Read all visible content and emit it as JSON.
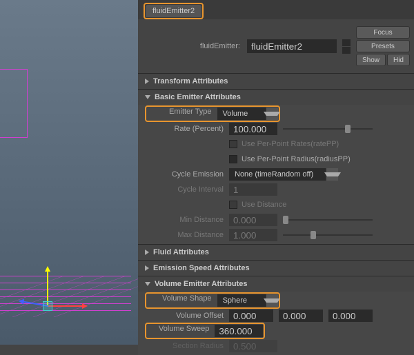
{
  "tab": {
    "title": "fluidEmitter2"
  },
  "header": {
    "name_label": "fluidEmitter:",
    "name_value": "fluidEmitter2",
    "focus": "Focus",
    "presets": "Presets",
    "show": "Show",
    "hide": "Hid"
  },
  "sections": {
    "transform": {
      "title": "Transform Attributes"
    },
    "basic": {
      "title": "Basic Emitter Attributes",
      "emitter_type_label": "Emitter Type",
      "emitter_type_value": "Volume",
      "rate_label": "Rate (Percent)",
      "rate_value": "100.000",
      "ratePP_label": "Use Per-Point Rates(ratePP)",
      "radiusPP_label": "Use Per-Point Radius(radiusPP)",
      "cycle_label": "Cycle Emission",
      "cycle_value": "None (timeRandom off)",
      "cycle_interval_label": "Cycle Interval",
      "cycle_interval_value": "1",
      "use_distance_label": "Use Distance",
      "min_dist_label": "Min Distance",
      "min_dist_value": "0.000",
      "max_dist_label": "Max Distance",
      "max_dist_value": "1.000"
    },
    "fluid": {
      "title": "Fluid Attributes"
    },
    "emission_speed": {
      "title": "Emission Speed Attributes"
    },
    "volume": {
      "title": "Volume Emitter Attributes",
      "shape_label": "Volume Shape",
      "shape_value": "Sphere",
      "offset_label": "Volume Offset",
      "offset_x": "0.000",
      "offset_y": "0.000",
      "offset_z": "0.000",
      "sweep_label": "Volume Sweep",
      "sweep_value": "360.000",
      "section_label": "Section Radius",
      "section_value": "0.500"
    }
  }
}
